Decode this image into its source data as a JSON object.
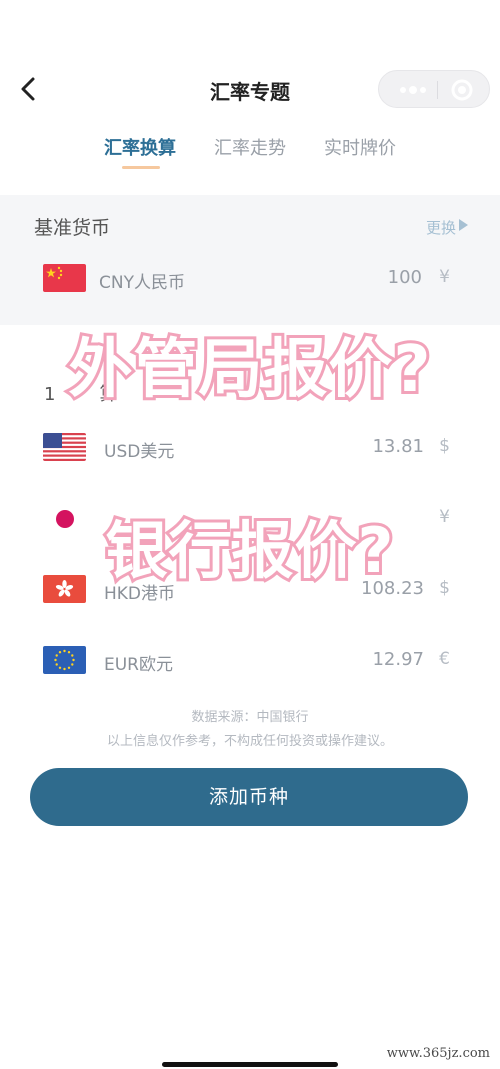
{
  "header": {
    "title": "汇率专题",
    "back_icon": "chevron-left-icon",
    "more_icon": "more-dots-icon",
    "close_icon": "target-ring-icon"
  },
  "tabs": [
    {
      "label": "汇率换算",
      "active": true
    },
    {
      "label": "汇率走势",
      "active": false
    },
    {
      "label": "实时牌价",
      "active": false
    }
  ],
  "base": {
    "section_title": "基准货币",
    "change_label": "更换",
    "currency": {
      "name": "CNY人民币",
      "amount": "100",
      "symbol": "¥",
      "flag": "china-flag-icon"
    }
  },
  "targets": {
    "section_title_visible_fragment": "算",
    "rows": [
      {
        "name": "USD美元",
        "amount": "13.81",
        "symbol": "$",
        "flag": "usa-flag-icon"
      },
      {
        "name": "",
        "amount": "",
        "symbol": "¥",
        "flag": "japan-flag-icon"
      },
      {
        "name": "HKD港币",
        "amount": "108.23",
        "symbol": "$",
        "flag": "hongkong-flag-icon"
      },
      {
        "name": "EUR欧元",
        "amount": "12.97",
        "symbol": "€",
        "flag": "eu-flag-icon"
      }
    ]
  },
  "footer": {
    "source": "数据来源：中国银行",
    "disclaimer": "以上信息仅作参考，不构成任何投资或操作建议。",
    "add_button": "添加币种"
  },
  "overlay": {
    "line1": "外管局报价?",
    "line2": "银行报价?"
  },
  "watermark": "www.365jz.com",
  "colors": {
    "accent": "#2f6b8d",
    "tab_active": "#2d6f96",
    "overlay_stroke": "#f2a3ba"
  }
}
